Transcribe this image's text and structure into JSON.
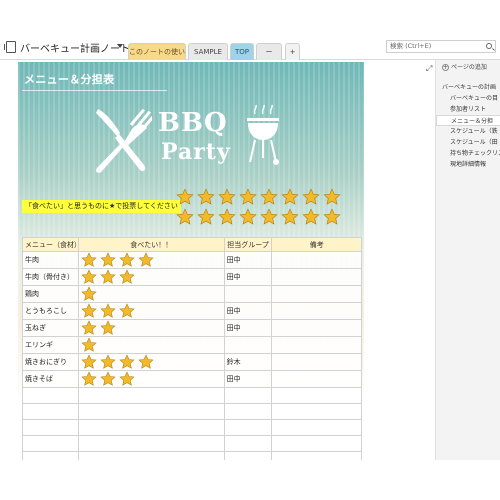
{
  "header": {
    "notebook_title": "バーベキュー計画ノート",
    "tabs": [
      "このノートの使い方",
      "SAMPLE",
      "TOP",
      "ー",
      "+"
    ],
    "search_placeholder": "検索 (Ctrl+E)"
  },
  "page": {
    "title": "メニュー＆分担表",
    "bbq": "BBQ",
    "party": "Party",
    "vote_label": "「食べたい」と思うものに★で投票してください",
    "vote_star_count": 16
  },
  "table": {
    "headers": [
      "メニュー（食材）",
      "食べたい！！",
      "担当グループ",
      "備考"
    ],
    "rows": [
      {
        "menu": "牛肉",
        "stars": 4,
        "group": "田中",
        "note": ""
      },
      {
        "menu": "牛肉（骨付き）",
        "stars": 3,
        "group": "田中",
        "note": ""
      },
      {
        "menu": "鶏肉",
        "stars": 1,
        "group": "",
        "note": ""
      },
      {
        "menu": "とうもろこし",
        "stars": 3,
        "group": "田中",
        "note": ""
      },
      {
        "menu": "玉ねぎ",
        "stars": 2,
        "group": "田中",
        "note": ""
      },
      {
        "menu": "エリンギ",
        "stars": 1,
        "group": "",
        "note": ""
      },
      {
        "menu": "焼きおにぎり",
        "stars": 4,
        "group": "鈴木",
        "note": ""
      },
      {
        "menu": "焼きそば",
        "stars": 3,
        "group": "田中",
        "note": ""
      },
      {
        "menu": "",
        "stars": 0,
        "group": "",
        "note": ""
      },
      {
        "menu": "",
        "stars": 0,
        "group": "",
        "note": ""
      },
      {
        "menu": "",
        "stars": 0,
        "group": "",
        "note": ""
      },
      {
        "menu": "",
        "stars": 0,
        "group": "",
        "note": ""
      },
      {
        "menu": "",
        "stars": 0,
        "group": "",
        "note": ""
      }
    ]
  },
  "sidebar": {
    "add_page": "ページの追加",
    "pages": [
      {
        "label": "バーベキューの計画",
        "active": false,
        "indent": 0
      },
      {
        "label": "バーベキューの目",
        "active": false,
        "indent": 1
      },
      {
        "label": "参加者リスト",
        "active": false,
        "indent": 1
      },
      {
        "label": "メニュー＆分担",
        "active": true,
        "indent": 1
      },
      {
        "label": "スケジュール（鉄",
        "active": false,
        "indent": 1
      },
      {
        "label": "スケジュール（田",
        "active": false,
        "indent": 1
      },
      {
        "label": "持ち物チェックリス",
        "active": false,
        "indent": 1
      },
      {
        "label": "現地詳細情報",
        "active": false,
        "indent": 1
      }
    ]
  },
  "colors": {
    "star_fill": "#f2b92a",
    "star_stroke": "#b07d10",
    "header_bg": "#fff3c9",
    "vote_highlight": "#ffff3a"
  }
}
